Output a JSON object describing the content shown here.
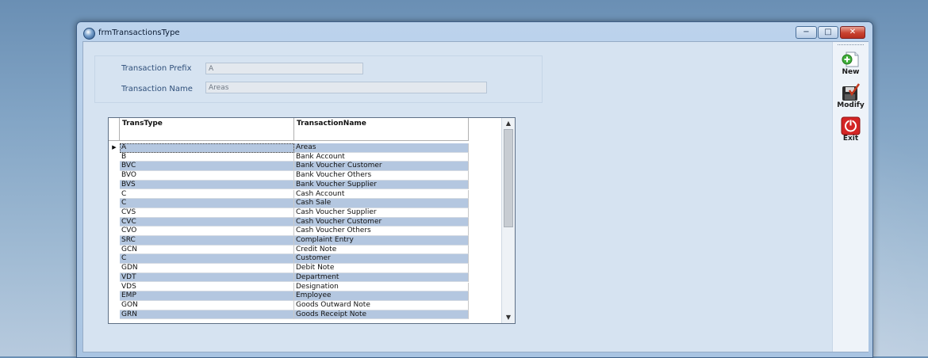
{
  "window": {
    "title": "frmTransactionsType",
    "controls": {
      "minimize": "−",
      "maximize": "□",
      "close": "✕"
    }
  },
  "form": {
    "prefix_label": "Transaction Prefix",
    "prefix_value": "A",
    "name_label": "Transaction Name",
    "name_value": "Areas"
  },
  "grid": {
    "columns": [
      "TransType",
      "TransactionName"
    ],
    "selected_indicator": "▶",
    "rows": [
      [
        "A",
        "Areas"
      ],
      [
        "B",
        "Bank Account"
      ],
      [
        "BVC",
        "Bank Voucher Customer"
      ],
      [
        "BVO",
        "Bank Voucher Others"
      ],
      [
        "BVS",
        "Bank Voucher Supplier"
      ],
      [
        "C",
        "Cash Account"
      ],
      [
        "C",
        "Cash Sale"
      ],
      [
        "CVS",
        "Cash Voucher  Supplier"
      ],
      [
        "CVC",
        "Cash Voucher Customer"
      ],
      [
        "CVO",
        "Cash Voucher Others"
      ],
      [
        "SRC",
        "Complaint Entry"
      ],
      [
        "GCN",
        "Credit Note"
      ],
      [
        "C",
        "Customer"
      ],
      [
        "GDN",
        "Debit Note"
      ],
      [
        "VDT",
        "Department"
      ],
      [
        "VDS",
        "Designation"
      ],
      [
        "EMP",
        "Employee"
      ],
      [
        "GON",
        "Goods Outward Note"
      ],
      [
        "GRN",
        "Goods Receipt Note"
      ]
    ],
    "scroll_up": "▲",
    "scroll_down": "▼"
  },
  "toolbar": {
    "new_label": "New",
    "modify_label": "Modify",
    "exit_label": "Exit"
  },
  "colors": {
    "alt_row": "#b4c7e0",
    "label_text": "#2f4f7a",
    "exit_red": "#d42525"
  }
}
